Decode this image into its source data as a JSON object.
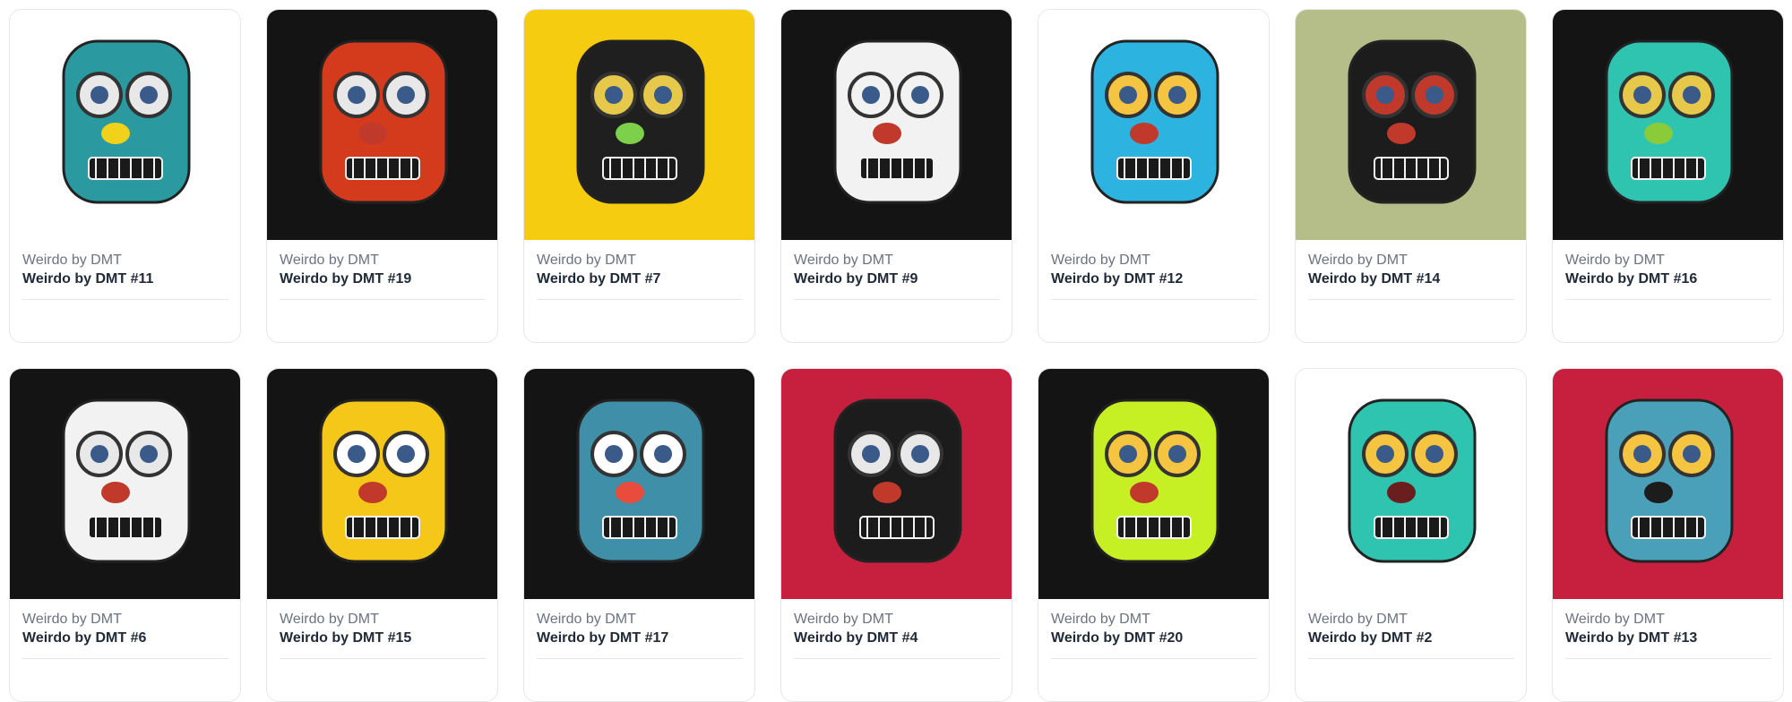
{
  "cards": [
    {
      "collection": "Weirdo by DMT",
      "title": "Weirdo by DMT #11",
      "bg": "#ffffff",
      "face": "#2a9aa0",
      "eye": "#e8e8e8",
      "accent": "#f2d11a"
    },
    {
      "collection": "Weirdo by DMT",
      "title": "Weirdo by DMT #19",
      "bg": "#141414",
      "face": "#d43b1d",
      "eye": "#e8e8e8",
      "accent": "#c0392b"
    },
    {
      "collection": "Weirdo by DMT",
      "title": "Weirdo by DMT #7",
      "bg": "#f5cc10",
      "face": "#1f1f1f",
      "eye": "#e6c84a",
      "accent": "#7cd04a"
    },
    {
      "collection": "Weirdo by DMT",
      "title": "Weirdo by DMT #9",
      "bg": "#141414",
      "face": "#f2f2f2",
      "eye": "#f2f2f2",
      "accent": "#c0392b"
    },
    {
      "collection": "Weirdo by DMT",
      "title": "Weirdo by DMT #12",
      "bg": "#ffffff",
      "face": "#2db3e0",
      "eye": "#f5c542",
      "accent": "#c0392b"
    },
    {
      "collection": "Weirdo by DMT",
      "title": "Weirdo by DMT #14",
      "bg": "#b5bd88",
      "face": "#1c1c1c",
      "eye": "#c0392b",
      "accent": "#c0392b"
    },
    {
      "collection": "Weirdo by DMT",
      "title": "Weirdo by DMT #16",
      "bg": "#141414",
      "face": "#2ec4b0",
      "eye": "#e6c84a",
      "accent": "#8acb3a"
    },
    {
      "collection": "Weirdo by DMT",
      "title": "Weirdo by DMT #6",
      "bg": "#141414",
      "face": "#f2f2f2",
      "eye": "#e8e8e8",
      "accent": "#c0392b"
    },
    {
      "collection": "Weirdo by DMT",
      "title": "Weirdo by DMT #15",
      "bg": "#141414",
      "face": "#f5c718",
      "eye": "#ffffff",
      "accent": "#c0392b"
    },
    {
      "collection": "Weirdo by DMT",
      "title": "Weirdo by DMT #17",
      "bg": "#141414",
      "face": "#3f8fa8",
      "eye": "#ffffff",
      "accent": "#e74c3c"
    },
    {
      "collection": "Weirdo by DMT",
      "title": "Weirdo by DMT #4",
      "bg": "#c7203f",
      "face": "#1c1c1c",
      "eye": "#e8e8e8",
      "accent": "#c0392b"
    },
    {
      "collection": "Weirdo by DMT",
      "title": "Weirdo by DMT #20",
      "bg": "#141414",
      "face": "#c6f024",
      "eye": "#f5c542",
      "accent": "#c0392b"
    },
    {
      "collection": "Weirdo by DMT",
      "title": "Weirdo by DMT #2",
      "bg": "#ffffff",
      "face": "#2ec4b0",
      "eye": "#f5c542",
      "accent": "#6b1e1e"
    },
    {
      "collection": "Weirdo by DMT",
      "title": "Weirdo by DMT #13",
      "bg": "#c7203f",
      "face": "#4aa0b8",
      "eye": "#f5c542",
      "accent": "#1c1c1c"
    }
  ]
}
